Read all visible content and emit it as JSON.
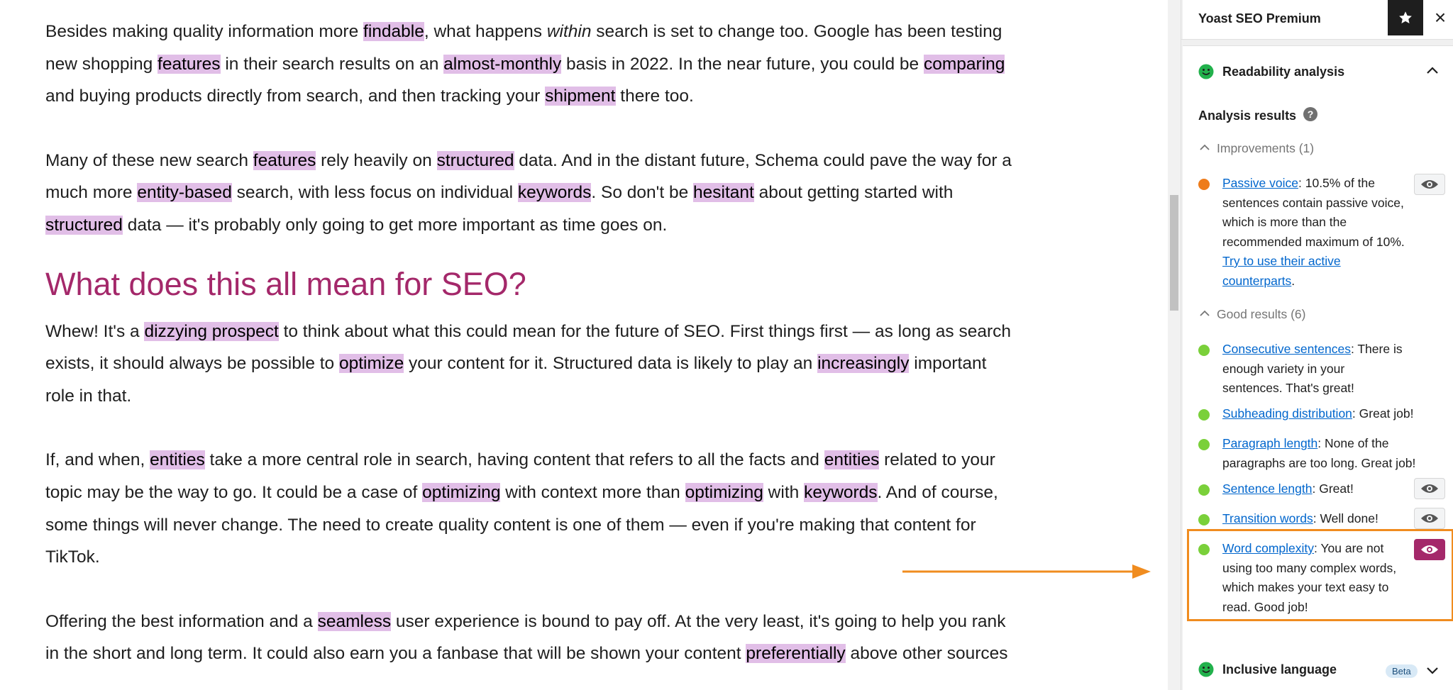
{
  "editor": {
    "p1": {
      "s1": "Besides making quality information more ",
      "h1": "findable",
      "s2": ", what happens ",
      "em": "within",
      "s3": " search is set to change too. Google has been testing",
      "s4": "new shopping ",
      "h2": "features",
      "s5": " in their search results on an ",
      "h3": "almost-monthly",
      "s6": " basis in 2022. In the near future, you could be ",
      "h4": "comparing",
      "s7": "and buying products directly from search, and then tracking your ",
      "h5": "shipment",
      "s8": " there too."
    },
    "p2": {
      "s1": "Many of these new search ",
      "h1": "features",
      "s2": " rely heavily on ",
      "h2": "structured",
      "s3": " data. And in the distant future, Schema could pave the way for a",
      "s4": "much more ",
      "h3": "entity-based",
      "s5": " search, with less focus on individual ",
      "h4": "keywords",
      "s6": ". So don't be ",
      "h5": "hesitant",
      "s7": " about getting started with",
      "h6": "structured",
      "s8": " data — it's probably only going to get more important as time goes on."
    },
    "heading": "What does this all mean for SEO?",
    "p3": {
      "s1": "Whew! It's a ",
      "h1": "dizzying prospect",
      "s2": " to think about what this could mean for the future of SEO. First things first — as long as search",
      "s3": "exists, it should always be possible to ",
      "h2": "optimize",
      "s4": " your content for it. Structured data is likely to play an ",
      "h3": "increasingly",
      "s5": " important",
      "s6": "role in that."
    },
    "p4": {
      "s1": "If, and when, ",
      "h1": "entities",
      "s2": " take a more central role in search, having content that refers to all the facts and ",
      "h2": "entities",
      "s3": " related to your",
      "s4": "topic may be the way to go. It could be a case of ",
      "h3": "optimizing",
      "s5": " with context more than ",
      "h4": "optimizing",
      "s6": " with ",
      "h5": "keywords",
      "s7": ". And of course,",
      "s8": "some things will never change. The need to create quality content is one of them — even if you're making that content for",
      "s9": "TikTok."
    },
    "p5": {
      "s1": "Offering the best information and a ",
      "h1": "seamless",
      "s2": " user experience is bound to pay off. At the very least, it's going to help you rank",
      "s3": "in the short and long term. It could also earn you a fanbase that will be shown your content ",
      "h2": "preferentially",
      "s4": " above other sources"
    }
  },
  "sidebar": {
    "title": "Yoast SEO Premium",
    "star_icon": "star-icon",
    "close_icon": "×",
    "readability": {
      "title": "Readability analysis",
      "results_title": "Analysis results",
      "help": "?",
      "improvements_label": "Improvements (1)",
      "good_label": "Good results (6)",
      "improvements": [
        {
          "link": "Passive voice",
          "text": ": 10.5% of the sentences contain passive voice, which is more than the recommended maximum of 10%. ",
          "link2": "Try to use their active counterparts",
          "tail": "."
        }
      ],
      "good": [
        {
          "link": "Consecutive sentences",
          "text": ": There is enough variety in your sentences. That's great!"
        },
        {
          "link": "Subheading distribution",
          "text": ": Great job!"
        },
        {
          "link": "Paragraph length",
          "text": ": None of the paragraphs are too long. Great job!"
        },
        {
          "link": "Sentence length",
          "text": ": Great!"
        },
        {
          "link": "Transition words",
          "text": ": Well done!"
        },
        {
          "link": "Word complexity",
          "text": ": You are not using too many complex words, which makes your text easy to read. Good job!"
        }
      ]
    },
    "inclusive": {
      "title": "Inclusive language",
      "badge": "Beta"
    }
  },
  "colors": {
    "highlight": "#e1bee7",
    "heading": "#a4286a",
    "link": "#0066cd",
    "orange": "#ee7c1b",
    "green": "#7ad03a",
    "active_eye": "#a4286a",
    "annotation": "#f08c1f"
  }
}
